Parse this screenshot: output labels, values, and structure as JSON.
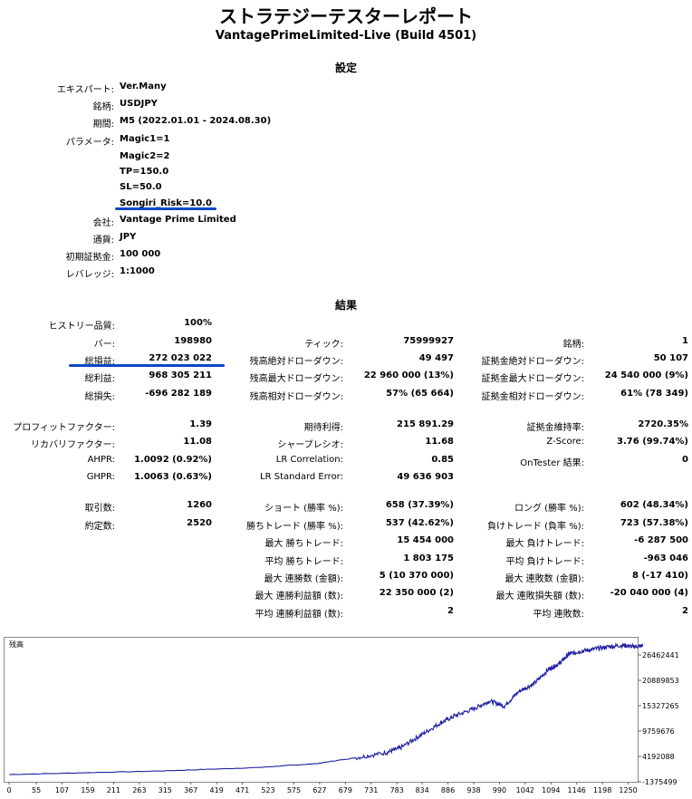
{
  "report": {
    "title": "ストラテジーテスターレポート",
    "subtitle": "VantagePrimeLimited-Live (Build 4501)"
  },
  "settings": {
    "heading": "設定",
    "rows": [
      {
        "label": "エキスパート:",
        "value": "Ver.Many"
      },
      {
        "label": "銘柄:",
        "value": "USDJPY"
      },
      {
        "label": "期間:",
        "value": "M5 (2022.01.01 - 2024.08.30)"
      },
      {
        "label": "パラメータ:",
        "value": "Magic1=1"
      },
      {
        "label": "",
        "value": "Magic2=2"
      },
      {
        "label": "",
        "value": "TP=150.0"
      },
      {
        "label": "",
        "value": "SL=50.0"
      },
      {
        "label": "",
        "value": "Songiri_Risk=10.0"
      },
      {
        "label": "会社:",
        "value": "Vantage Prime Limited"
      },
      {
        "label": "通貨:",
        "value": "JPY"
      },
      {
        "label": "初期証拠金:",
        "value": "100 000"
      },
      {
        "label": "レバレッジ:",
        "value": "1:1000"
      }
    ]
  },
  "results": {
    "heading": "結果",
    "col1": [
      {
        "label": "ヒストリー品質:",
        "value": "100%"
      },
      {
        "label": "バー:",
        "value": "198980"
      },
      {
        "label": "総損益:",
        "value": "272 023 022"
      },
      {
        "label": "総利益:",
        "value": "968 305 211"
      },
      {
        "label": "総損失:",
        "value": "-696 282 189"
      },
      {
        "label": "プロフィットファクター:",
        "value": "1.39"
      },
      {
        "label": "リカバリファクター:",
        "value": "11.08"
      },
      {
        "label": "AHPR:",
        "value": "1.0092 (0.92%)"
      },
      {
        "label": "GHPR:",
        "value": "1.0063 (0.63%)"
      },
      {
        "label": "取引数:",
        "value": "1260"
      },
      {
        "label": "約定数:",
        "value": "2520"
      }
    ],
    "col2": [
      {
        "label": "ティック:",
        "value": "75999927"
      },
      {
        "label": "残高絶対ドローダウン:",
        "value": "49 497"
      },
      {
        "label": "残高最大ドローダウン:",
        "value": "22 960 000 (13%)"
      },
      {
        "label": "残高相対ドローダウン:",
        "value": "57% (65 664)"
      },
      {
        "label": "期待利得:",
        "value": "215 891.29"
      },
      {
        "label": "シャープレシオ:",
        "value": "11.68"
      },
      {
        "label": "LR Correlation:",
        "value": "0.85"
      },
      {
        "label": "LR Standard Error:",
        "value": "49 636 903"
      },
      {
        "label": "ショート (勝率 %):",
        "value": "658 (37.39%)"
      },
      {
        "label": "勝ちトレード (勝率 %):",
        "value": "537 (42.62%)"
      },
      {
        "label": "最大 勝ちトレード:",
        "value": "15 454 000"
      },
      {
        "label": "平均 勝ちトレード:",
        "value": "1 803 175"
      },
      {
        "label": "最大 連勝数 (金額):",
        "value": "5 (10 370 000)"
      },
      {
        "label": "最大 連勝利益額 (数):",
        "value": "22 350 000 (2)"
      },
      {
        "label": "平均 連勝利益額 (数):",
        "value": "2"
      }
    ],
    "col3": [
      {
        "label": "銘柄:",
        "value": "1"
      },
      {
        "label": "証拠金絶対ドローダウン:",
        "value": "50 107"
      },
      {
        "label": "証拠金最大ドローダウン:",
        "value": "24 540 000 (9%)"
      },
      {
        "label": "証拠金相対ドローダウン:",
        "value": "61% (78 349)"
      },
      {
        "label": "証拠金維持率:",
        "value": "2720.35%"
      },
      {
        "label": "Z-Score:",
        "value": "3.76 (99.74%)"
      },
      {
        "label": "OnTester 結果:",
        "value": "0"
      },
      {
        "label": "ロング (勝率 %):",
        "value": "602 (48.34%)"
      },
      {
        "label": "負けトレード (負率 %):",
        "value": "723 (57.38%)"
      },
      {
        "label": "最大 負けトレード:",
        "value": "-6 287 500"
      },
      {
        "label": "平均 負けトレード:",
        "value": "-963 046"
      },
      {
        "label": "最大 連敗数 (金額):",
        "value": "8 (-17 410)"
      },
      {
        "label": "最大 連敗損失額 (数):",
        "value": "-20 040 000 (4)"
      },
      {
        "label": "平均 連敗数:",
        "value": "2"
      }
    ]
  },
  "chart_data": {
    "type": "line",
    "title": "残高",
    "color": "#2020a0",
    "x_ticks": [
      0,
      55,
      107,
      159,
      211,
      263,
      315,
      367,
      419,
      471,
      523,
      575,
      627,
      679,
      731,
      783,
      834,
      886,
      938,
      990,
      1042,
      1094,
      1146,
      1198,
      1250
    ],
    "y_ticks": [
      "26462441",
      "20889853",
      "15327265",
      "9759676",
      "4192088",
      "-1375499"
    ],
    "xlim": [
      0,
      1280
    ],
    "ylim": [
      -1375499,
      28000000
    ],
    "series": [
      {
        "x": [
          0,
          300,
          500,
          620,
          700,
          760,
          790,
          830,
          870,
          900,
          940,
          970,
          1000,
          1030,
          1060,
          1090,
          1110,
          1130,
          1150,
          1180,
          1210,
          1240,
          1260,
          1280
        ],
        "values": [
          100000,
          800000,
          1500000,
          2300000,
          3500000,
          4500000,
          5500000,
          8000000,
          10500000,
          12000000,
          13500000,
          15000000,
          14000000,
          17000000,
          18500000,
          21500000,
          22500000,
          24500000,
          25000000,
          25500000,
          26000000,
          26300000,
          26000000,
          26200000
        ]
      }
    ]
  }
}
